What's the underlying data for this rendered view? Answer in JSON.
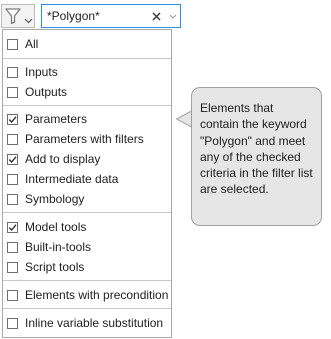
{
  "toolbar": {
    "filter_button": {
      "icon": "funnel-icon",
      "caret_icon": "chevron-down-icon"
    },
    "search": {
      "value": "*Polygon*",
      "clear_icon": "close-icon",
      "dropdown_icon": "chevron-down-icon"
    }
  },
  "menu": {
    "items": [
      {
        "label": "All",
        "checked": false
      },
      {
        "label": "Inputs",
        "checked": false
      },
      {
        "label": "Outputs",
        "checked": false
      },
      {
        "label": "Parameters",
        "checked": true
      },
      {
        "label": "Parameters with filters",
        "checked": false
      },
      {
        "label": "Add to display",
        "checked": true
      },
      {
        "label": "Intermediate data",
        "checked": false
      },
      {
        "label": "Symbology",
        "checked": false
      },
      {
        "label": "Model tools",
        "checked": true
      },
      {
        "label": "Built-in-tools",
        "checked": false
      },
      {
        "label": "Script tools",
        "checked": false
      },
      {
        "label": "Elements with precondition",
        "checked": false
      },
      {
        "label": "Inline variable substitution",
        "checked": false
      }
    ]
  },
  "tooltip": {
    "text": "Elements that contain the keyword \"Polygon\" and meet any of the checked criteria in the filter list are selected."
  },
  "colors": {
    "accent_border": "#2f8ee5",
    "tooltip_bg": "#e6e6e6",
    "funnel_gray": "#8a8a8a"
  }
}
